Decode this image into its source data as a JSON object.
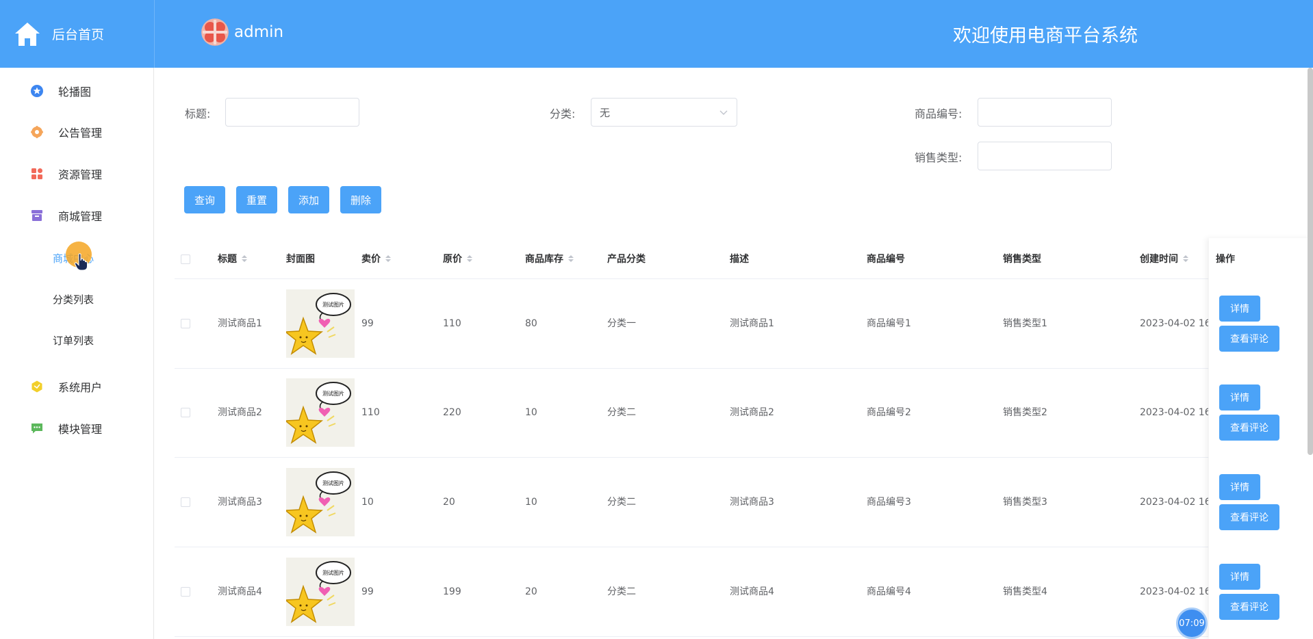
{
  "header": {
    "home_label": "后台首页",
    "user_name": "admin",
    "welcome": "欢迎使用电商平台系统",
    "bg_color": "#4ba3f8"
  },
  "sidebar": {
    "items": [
      {
        "label": "轮播图",
        "icon": "star-badge-icon",
        "color": "#3d86f0"
      },
      {
        "label": "公告管理",
        "icon": "gear-badge-icon",
        "color": "#f5a55a"
      },
      {
        "label": "资源管理",
        "icon": "grid-icon",
        "color": "#f26a5a"
      },
      {
        "label": "商城管理",
        "icon": "archive-box-icon",
        "color": "#8a6fd8"
      },
      {
        "label": "系统用户",
        "icon": "hexagon-icon",
        "color": "#f2cf2a"
      },
      {
        "label": "模块管理",
        "icon": "chat-icon",
        "color": "#5cb85c"
      }
    ],
    "sub_items": [
      {
        "label": "商城中心",
        "active": true
      },
      {
        "label": "分类列表",
        "active": false
      },
      {
        "label": "订单列表",
        "active": false
      }
    ]
  },
  "search": {
    "title_label": "标题:",
    "title_value": "",
    "category_label": "分类:",
    "category_value": "无",
    "code_label": "商品编号:",
    "code_value": "",
    "sale_type_label": "销售类型:",
    "sale_type_value": ""
  },
  "buttons": {
    "query": "查询",
    "reset": "重置",
    "add": "添加",
    "delete": "删除"
  },
  "table": {
    "headers": {
      "title": "标题",
      "cover": "封面图",
      "price": "卖价",
      "original_price": "原价",
      "stock": "商品库存",
      "category": "产品分类",
      "description": "描述",
      "code": "商品编号",
      "sale_type": "销售类型",
      "created": "创建时间",
      "actions": "操作"
    },
    "thumb_text": "测试图片",
    "rows": [
      {
        "title": "测试商品1",
        "price": "99",
        "original_price": "110",
        "stock": "80",
        "category": "分类一",
        "description": "测试商品1",
        "code": "商品编号1",
        "sale_type": "销售类型1",
        "created": "2023-04-02 16:",
        "detail": "详情",
        "comment": "查看评论"
      },
      {
        "title": "测试商品2",
        "price": "110",
        "original_price": "220",
        "stock": "10",
        "category": "分类二",
        "description": "测试商品2",
        "code": "商品编号2",
        "sale_type": "销售类型2",
        "created": "2023-04-02 16:",
        "detail": "详情",
        "comment": "查看评论"
      },
      {
        "title": "测试商品3",
        "price": "10",
        "original_price": "20",
        "stock": "10",
        "category": "分类二",
        "description": "测试商品3",
        "code": "商品编号3",
        "sale_type": "销售类型3",
        "created": "2023-04-02 16:",
        "detail": "详情",
        "comment": "查看评论"
      },
      {
        "title": "测试商品4",
        "price": "99",
        "original_price": "199",
        "stock": "20",
        "category": "分类二",
        "description": "测试商品4",
        "code": "商品编号4",
        "sale_type": "销售类型4",
        "created": "2023-04-02 16:",
        "detail": "详情",
        "comment": "查看评论"
      }
    ]
  },
  "timer": "07:09"
}
